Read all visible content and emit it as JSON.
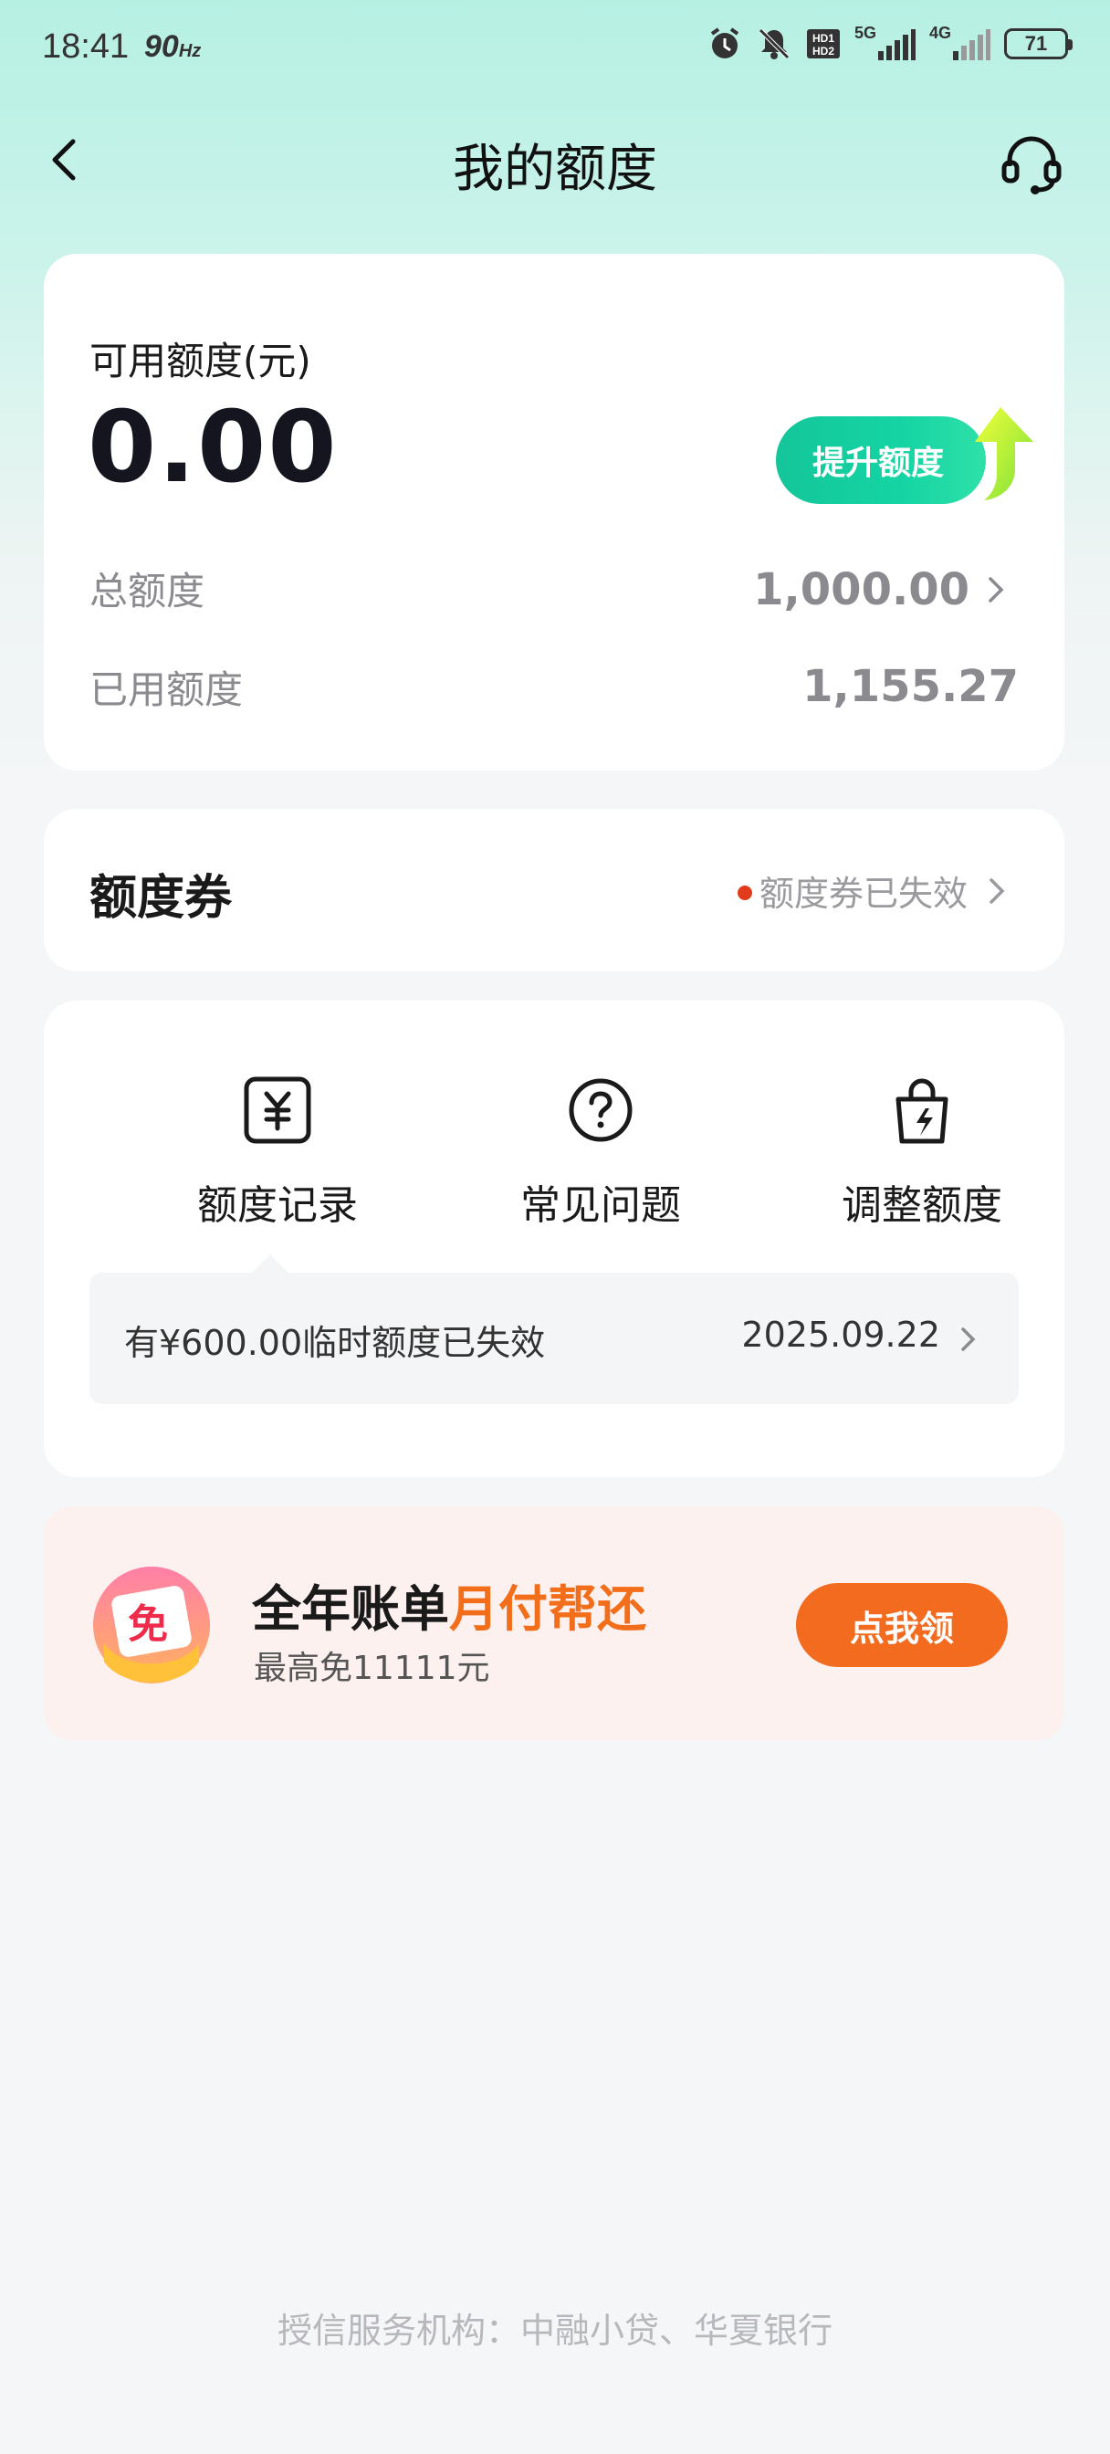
{
  "status_bar": {
    "time": "18:41",
    "refresh_rate": "90",
    "refresh_unit": "Hz",
    "network_1": "5G",
    "network_2": "4G",
    "sim_label": "HD",
    "battery": "71"
  },
  "nav": {
    "title": "我的额度"
  },
  "credit": {
    "available_label": "可用额度(元)",
    "available_value": "0.00",
    "raise_button": "提升额度",
    "total_label": "总额度",
    "total_value": "1,000.00",
    "used_label": "已用额度",
    "used_value": "1,155.27"
  },
  "coupon": {
    "title": "额度券",
    "status": "额度券已失效"
  },
  "actions": {
    "items": [
      {
        "label": "额度记录",
        "icon": "yen-receipt-icon"
      },
      {
        "label": "常见问题",
        "icon": "question-circle-icon"
      },
      {
        "label": "调整额度",
        "icon": "lightning-bag-icon"
      }
    ],
    "notice_text": "有¥600.00临时额度已失效",
    "notice_date": "2025.09.22"
  },
  "promo": {
    "title_prefix": "全年账单",
    "title_highlight": "月付帮还",
    "subtitle": "最高免11111元",
    "logo_char": "免",
    "button": "点我领"
  },
  "footer": {
    "text": "授信服务机构：中融小贷、华夏银行"
  },
  "colors": {
    "accent_green": "#14c69a",
    "promo_orange": "#f36b1f",
    "highlight_orange": "#f26e1a",
    "status_red": "#e23a1c"
  }
}
